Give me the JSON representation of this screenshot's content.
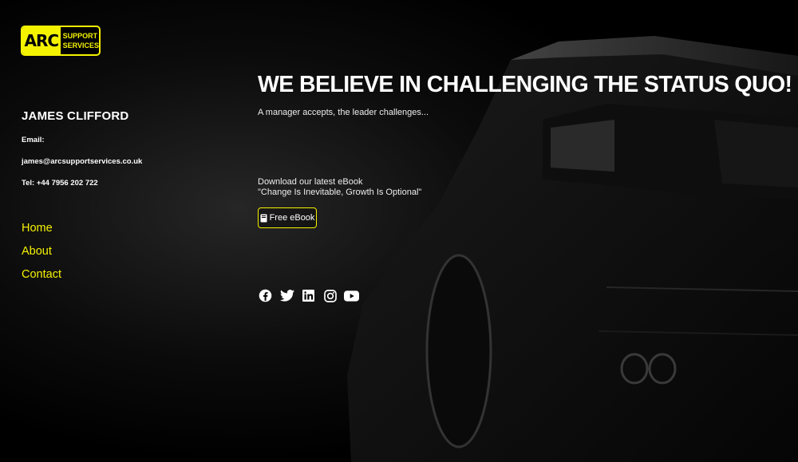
{
  "logo": {
    "main": "ARC",
    "line1": "SUPPORT",
    "line2": "SERVICES"
  },
  "contact": {
    "name": "JAMES CLIFFORD",
    "email_label": "Email:",
    "email": "james@arcsupportservices.co.uk",
    "tel": "Tel: +44 7956 202 722"
  },
  "nav": {
    "items": [
      {
        "label": "Home"
      },
      {
        "label": "About"
      },
      {
        "label": "Contact"
      }
    ]
  },
  "hero": {
    "headline": "WE BELIEVE IN CHALLENGING THE STATUS QUO!",
    "tagline": "A manager accepts, the leader challenges...",
    "download_line1": "Download our latest eBook",
    "download_line2": "\"Change Is Inevitable, Growth Is Optional\"",
    "ebook_button": "Free eBook"
  },
  "social": [
    "facebook-icon",
    "twitter-icon",
    "linkedin-icon",
    "instagram-icon",
    "youtube-icon"
  ],
  "colors": {
    "accent": "#f5f200",
    "background": "#000000",
    "text": "#ffffff"
  }
}
